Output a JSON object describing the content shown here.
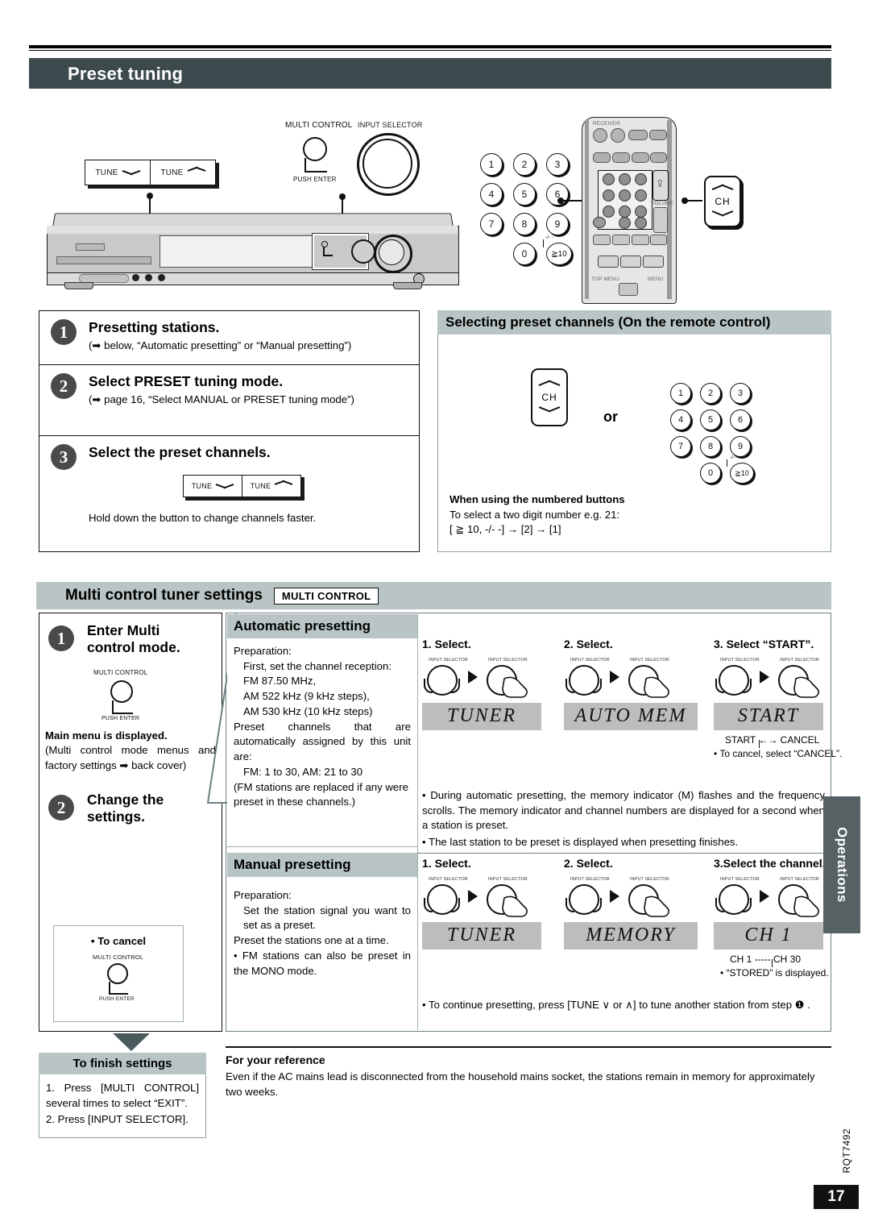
{
  "document": {
    "title": "Preset tuning",
    "page_number": "17",
    "doc_code": "RQT7492",
    "side_tab": "Operations"
  },
  "hardware_callouts": {
    "multi_control_label": "MULTI CONTROL",
    "input_selector_label": "INPUT SELECTOR",
    "push_enter_label": "PUSH ENTER",
    "tune_down_label": "TUNE",
    "tune_up_label": "TUNE",
    "ch_label": "CH",
    "keypad": [
      "1",
      "2",
      "3",
      "4",
      "5",
      "6",
      "7",
      "8",
      "9",
      "0"
    ],
    "ten_key_label": "≧10",
    "ten_key_sub": "-/- -"
  },
  "steps_main": [
    {
      "num": "1",
      "heading": "Presetting stations.",
      "sub": "(➡ below, “Automatic presetting” or “Manual presetting”)"
    },
    {
      "num": "2",
      "heading": "Select PRESET tuning mode.",
      "sub": "(➡ page 16, “Select MANUAL or PRESET tuning mode”)"
    },
    {
      "num": "3",
      "heading": "Select the preset channels.",
      "sub": "Hold down the button to change channels faster."
    }
  ],
  "selecting_preset": {
    "heading": "Selecting preset channels (On the remote control)",
    "or_label": "or",
    "note_title": "When using the numbered buttons",
    "note_line1": "To select a two digit number e.g. 21:",
    "note_line2": "[ ≧ 10, -/- -] → [2] → [1]"
  },
  "multi_control": {
    "banner_title": "Multi control tuner settings",
    "banner_tag": "MULTI CONTROL",
    "step1_num": "1",
    "step1_heading_line1": "Enter Multi",
    "step1_heading_line2": "control mode.",
    "step1_knob_label": "MULTI CONTROL",
    "step1_push_label": "PUSH ENTER",
    "step1_bold": "Main menu is displayed.",
    "step1_body": "(Multi control mode menus and factory settings ➡ back cover)",
    "step2_num": "2",
    "step2_heading_line1": "Change the",
    "step2_heading_line2": "settings.",
    "cancel_title": "• To cancel",
    "cancel_knob_label": "MULTI CONTROL",
    "cancel_push_label": "PUSH ENTER"
  },
  "automatic_presetting": {
    "heading": "Automatic presetting",
    "prep_label": "Preparation:",
    "prep_lines": [
      "First, set the channel reception:",
      "FM 87.50 MHz,",
      "AM 522 kHz (9 kHz steps),",
      "AM 530 kHz (10 kHz steps)"
    ],
    "body1": "Preset channels that are automatically assigned by this unit are:",
    "body2": "FM: 1 to 30, AM: 21 to 30",
    "body3": "(FM stations are replaced if any were preset in these channels.)",
    "steps": [
      {
        "label": "1. Select.",
        "display": "TUNER"
      },
      {
        "label": "2. Select.",
        "display": "AUTO MEM"
      },
      {
        "label": "3. Select “START”.",
        "display": "START"
      }
    ],
    "knob_caption": "INPUT SELECTOR",
    "start_cancel_toggle": "START ←→ CANCEL",
    "cancel_note": "• To cancel, select “CANCEL”.",
    "notes": [
      "• During automatic presetting, the memory indicator (M) flashes and the frequency scrolls. The memory indicator and channel numbers are displayed for a second when a station is preset.",
      "• The last station to be preset is displayed when presetting finishes."
    ],
    "memory_indicator_glyph": "M"
  },
  "manual_presetting": {
    "heading": "Manual presetting",
    "prep_label": "Preparation:",
    "prep_line1": "Set the station signal you want to set as a preset.",
    "body1": "Preset the stations one at a time.",
    "body2": "• FM stations can also be preset in the MONO mode.",
    "steps": [
      {
        "label": "1. Select.",
        "display": "TUNER"
      },
      {
        "label": "2. Select.",
        "display": "MEMORY"
      },
      {
        "label": "3.Select the channel.",
        "display": "CH  1"
      }
    ],
    "knob_caption": "INPUT SELECTOR",
    "ch_range": "CH 1 ----- CH 30",
    "stored_note": "• “STORED” is displayed.",
    "continue_note": "• To continue presetting, press [TUNE ∨ or ∧] to tune another station from step ❶ ."
  },
  "finish_settings": {
    "heading": "To finish settings",
    "item1": "1. Press [MULTI CONTROL] several times to select “EXIT”.",
    "item2": "2. Press [INPUT SELECTOR]."
  },
  "for_your_reference": {
    "heading": "For your reference",
    "body": "Even if the AC mains lead is disconnected from the household mains socket, the stations remain in memory for approximately two weeks."
  },
  "colors": {
    "title_bar": "#3c4a4d",
    "panel_head": "#b9c5c5",
    "lcd": "#bdbdbd",
    "side_tab": "#566164",
    "badge": "#4a4a4a"
  }
}
